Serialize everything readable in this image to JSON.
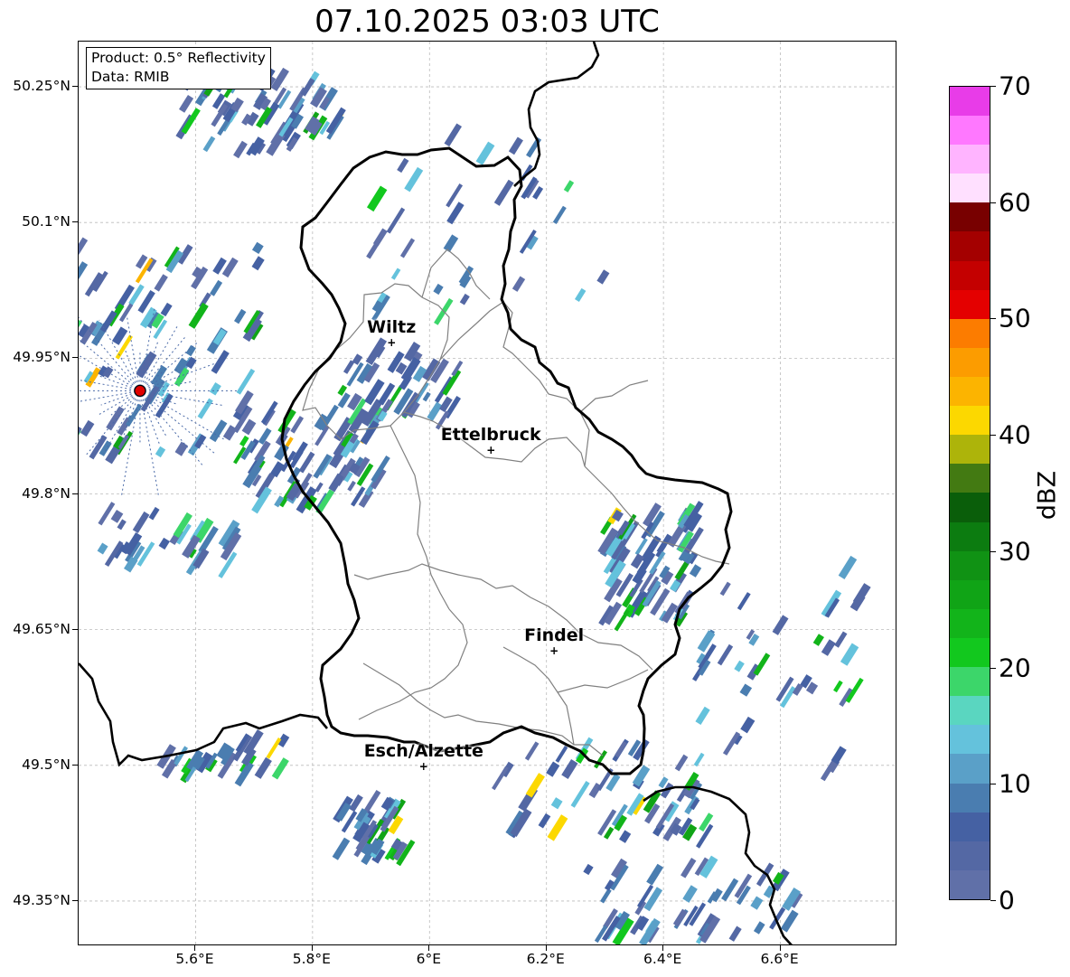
{
  "title": "07.10.2025 03:03 UTC",
  "info_box": {
    "product": "Product: 0.5° Reflectivity",
    "data": "Data: RMIB"
  },
  "map": {
    "lon_range": [
      5.4,
      6.8
    ],
    "lat_range": [
      49.3,
      50.3
    ],
    "lat_ticks": [
      {
        "value": 50.25,
        "label": "50.25°N"
      },
      {
        "value": 50.1,
        "label": "50.1°N"
      },
      {
        "value": 49.95,
        "label": "49.95°N"
      },
      {
        "value": 49.8,
        "label": "49.8°N"
      },
      {
        "value": 49.65,
        "label": "49.65°N"
      },
      {
        "value": 49.5,
        "label": "49.5°N"
      },
      {
        "value": 49.35,
        "label": "49.35°N"
      }
    ],
    "lon_ticks": [
      {
        "value": 5.6,
        "label": "5.6°E"
      },
      {
        "value": 5.8,
        "label": "5.8°E"
      },
      {
        "value": 6.0,
        "label": "6°E"
      },
      {
        "value": 6.2,
        "label": "6.2°E"
      },
      {
        "value": 6.4,
        "label": "6.4°E"
      },
      {
        "value": 6.6,
        "label": "6.6°E"
      }
    ],
    "grid": true,
    "cities": [
      {
        "name": "Wiltz",
        "lon": 5.935,
        "lat": 49.967
      },
      {
        "name": "Ettelbruck",
        "lon": 6.105,
        "lat": 49.848
      },
      {
        "name": "Findel",
        "lon": 6.213,
        "lat": 49.627
      },
      {
        "name": "Esch/Alzette",
        "lon": 5.99,
        "lat": 49.499
      }
    ],
    "radar_site": {
      "lon": 5.505,
      "lat": 49.914,
      "color": "#e00000"
    },
    "echo_areas": [
      {
        "lon": 5.72,
        "lat": 50.22,
        "count": 60,
        "spread_lon": 0.14,
        "spread_lat": 0.04
      },
      {
        "lon": 5.55,
        "lat": 49.96,
        "count": 90,
        "spread_lon": 0.16,
        "spread_lat": 0.12
      },
      {
        "lon": 5.8,
        "lat": 49.84,
        "count": 70,
        "spread_lon": 0.12,
        "spread_lat": 0.05
      },
      {
        "lon": 5.95,
        "lat": 49.92,
        "count": 40,
        "spread_lon": 0.1,
        "spread_lat": 0.04
      },
      {
        "lon": 6.38,
        "lat": 49.72,
        "count": 80,
        "spread_lon": 0.08,
        "spread_lat": 0.06
      },
      {
        "lon": 5.9,
        "lat": 49.43,
        "count": 35,
        "spread_lon": 0.06,
        "spread_lat": 0.03
      },
      {
        "lon": 6.3,
        "lat": 49.47,
        "count": 55,
        "spread_lon": 0.18,
        "spread_lat": 0.05
      },
      {
        "lon": 6.45,
        "lat": 49.35,
        "count": 50,
        "spread_lon": 0.2,
        "spread_lat": 0.04
      },
      {
        "lon": 6.6,
        "lat": 49.6,
        "count": 40,
        "spread_lon": 0.14,
        "spread_lat": 0.12
      },
      {
        "lon": 6.1,
        "lat": 50.1,
        "count": 35,
        "spread_lon": 0.2,
        "spread_lat": 0.1
      },
      {
        "lon": 5.55,
        "lat": 49.75,
        "count": 30,
        "spread_lon": 0.12,
        "spread_lat": 0.03
      },
      {
        "lon": 5.65,
        "lat": 49.51,
        "count": 25,
        "spread_lon": 0.1,
        "spread_lat": 0.02
      }
    ]
  },
  "colorbar": {
    "unit": "dBZ",
    "ticks": [
      {
        "value": 0,
        "label": "0"
      },
      {
        "value": 10,
        "label": "10"
      },
      {
        "value": 20,
        "label": "20"
      },
      {
        "value": 30,
        "label": "30"
      },
      {
        "value": 40,
        "label": "40"
      },
      {
        "value": 50,
        "label": "50"
      },
      {
        "value": 60,
        "label": "60"
      },
      {
        "value": 70,
        "label": "70"
      }
    ],
    "range": [
      0,
      70
    ],
    "colors": [
      "#6070a8",
      "#5468a4",
      "#4561a3",
      "#4a7db0",
      "#5aa0c8",
      "#64c2dc",
      "#5ad6c0",
      "#3cd66a",
      "#12c81e",
      "#12b41a",
      "#10a416",
      "#109214",
      "#0c7c10",
      "#0a5e0a",
      "#437a12",
      "#adb40a",
      "#fcd800",
      "#fcb400",
      "#fc9c00",
      "#fc7c00",
      "#e40000",
      "#c40000",
      "#a40000",
      "#780000",
      "#ffe0ff",
      "#ffb4ff",
      "#ff78ff",
      "#e83ce8"
    ]
  }
}
